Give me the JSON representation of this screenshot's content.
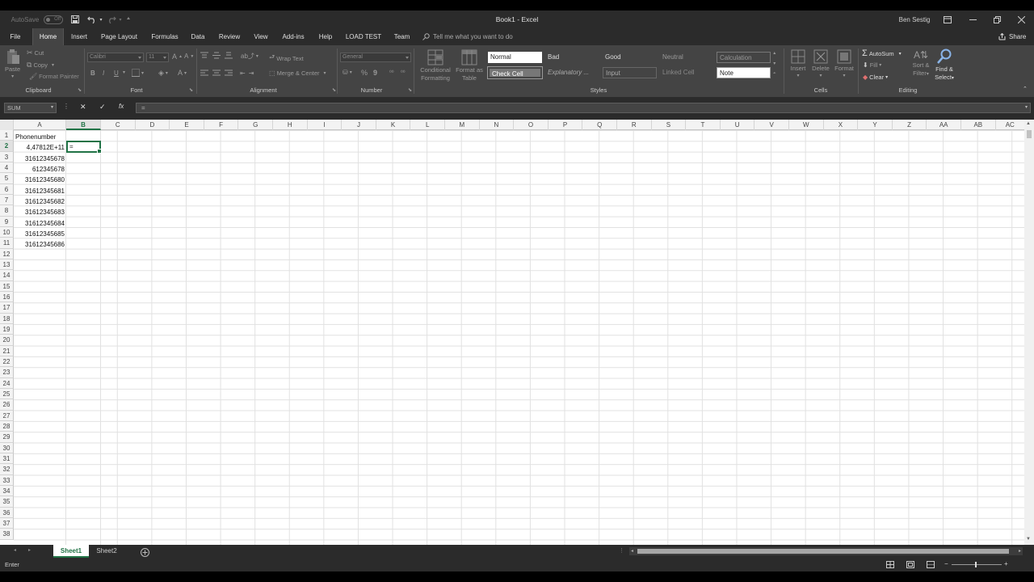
{
  "title_bar": {
    "autosave_label": "AutoSave",
    "autosave_state": "Off",
    "title": "Book1  -  Excel",
    "user": "Ben Sestig"
  },
  "tabs": [
    "File",
    "Home",
    "Insert",
    "Page Layout",
    "Formulas",
    "Data",
    "Review",
    "View",
    "Add-ins",
    "Help",
    "LOAD TEST",
    "Team"
  ],
  "tell_me": "Tell me what you want to do",
  "share": "Share",
  "ribbon": {
    "clipboard": {
      "paste": "Paste",
      "cut": "Cut",
      "copy": "Copy",
      "format_painter": "Format Painter",
      "label": "Clipboard"
    },
    "font": {
      "name": "Calibri",
      "size": "11",
      "label": "Font",
      "bold": "B",
      "italic": "I",
      "underline": "U"
    },
    "alignment": {
      "wrap": "Wrap Text",
      "merge": "Merge & Center",
      "label": "Alignment"
    },
    "number": {
      "format": "General",
      "percent": "%",
      "comma": "9",
      "label": "Number"
    },
    "styles": {
      "conditional_1": "Conditional",
      "conditional_2": "Formatting",
      "format_table_1": "Format as",
      "format_table_2": "Table",
      "cells": [
        "Normal",
        "Bad",
        "Good",
        "Neutral",
        "Calculation",
        "Check Cell",
        "Explanatory ...",
        "Input",
        "Linked Cell",
        "Note"
      ],
      "label": "Styles"
    },
    "cells": {
      "insert": "Insert",
      "delete": "Delete",
      "format": "Format",
      "label": "Cells"
    },
    "editing": {
      "autosum": "AutoSum",
      "fill": "Fill",
      "clear": "Clear",
      "sort_1": "Sort &",
      "sort_2": "Filter",
      "find_1": "Find &",
      "find_2": "Select",
      "label": "Editing"
    }
  },
  "formula_bar": {
    "name_box": "SUM",
    "cancel": "✕",
    "enter": "✓",
    "fx": "fx",
    "value": "="
  },
  "columns": [
    "A",
    "B",
    "C",
    "D",
    "E",
    "F",
    "G",
    "H",
    "I",
    "J",
    "K",
    "L",
    "M",
    "N",
    "O",
    "P",
    "Q",
    "R",
    "S",
    "T",
    "U",
    "V",
    "W",
    "X",
    "Y",
    "Z",
    "AA",
    "AB",
    "AC"
  ],
  "rows": [
    "1",
    "2",
    "3",
    "4",
    "5",
    "6",
    "7",
    "8",
    "9",
    "10",
    "11",
    "12",
    "13",
    "14",
    "15",
    "16",
    "17",
    "18",
    "19",
    "20",
    "21",
    "22",
    "23",
    "24",
    "25",
    "26",
    "27",
    "28",
    "29",
    "30",
    "31",
    "32",
    "33",
    "34",
    "35",
    "36",
    "37",
    "38"
  ],
  "sheet": {
    "header": "Phonenumber",
    "values": [
      "4,47812E+11",
      "31612345678",
      "612345678",
      "31612345680",
      "31612345681",
      "31612345682",
      "31612345683",
      "31612345684",
      "31612345685",
      "31612345686"
    ],
    "active_cell_value": "="
  },
  "sheet_tabs": [
    "Sheet1",
    "Sheet2"
  ],
  "status": {
    "mode": "Enter"
  },
  "colors": {
    "accent": "#217346",
    "ribbon": "#444444",
    "chrome": "#2b2b2b"
  }
}
